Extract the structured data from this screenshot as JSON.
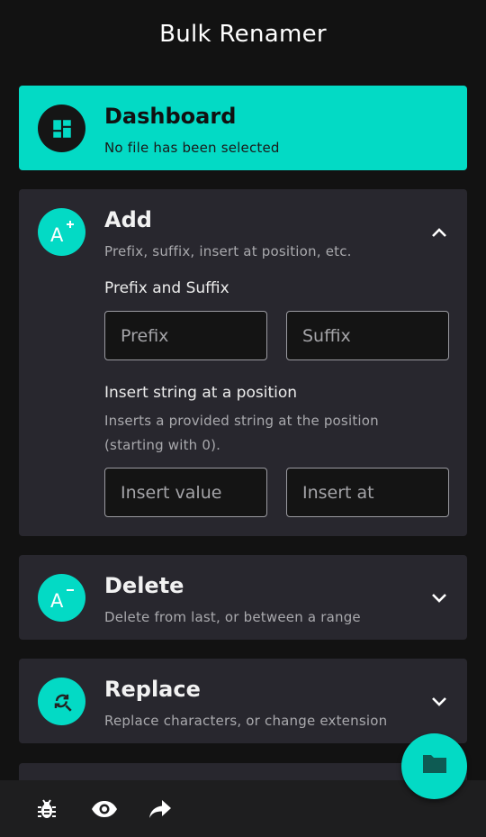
{
  "app": {
    "title": "Bulk Renamer"
  },
  "colors": {
    "accent": "#03dac5",
    "background": "#121212",
    "card": "#28272e"
  },
  "dashboard": {
    "title": "Dashboard",
    "subtitle": "No file has been selected",
    "icon": "dashboard-icon"
  },
  "add": {
    "title": "Add",
    "subtitle": "Prefix, suffix, insert at position, etc.",
    "icon": "text-add-icon",
    "expanded": true,
    "prefix_suffix": {
      "label": "Prefix and Suffix",
      "prefix_placeholder": "Prefix",
      "suffix_placeholder": "Suffix"
    },
    "insert": {
      "label": "Insert string at a position",
      "description": "Inserts a provided string at the position (starting with 0).",
      "value_placeholder": "Insert value",
      "position_placeholder": "Insert at"
    }
  },
  "delete": {
    "title": "Delete",
    "subtitle": "Delete from last, or between a range",
    "icon": "text-remove-icon",
    "expanded": false
  },
  "replace": {
    "title": "Replace",
    "subtitle": "Replace characters, or change extension",
    "icon": "find-replace-icon",
    "expanded": false
  },
  "bottom_bar": {
    "actions": [
      "bug-icon",
      "eye-icon",
      "share-icon"
    ]
  },
  "fab": {
    "icon": "folder-icon"
  }
}
